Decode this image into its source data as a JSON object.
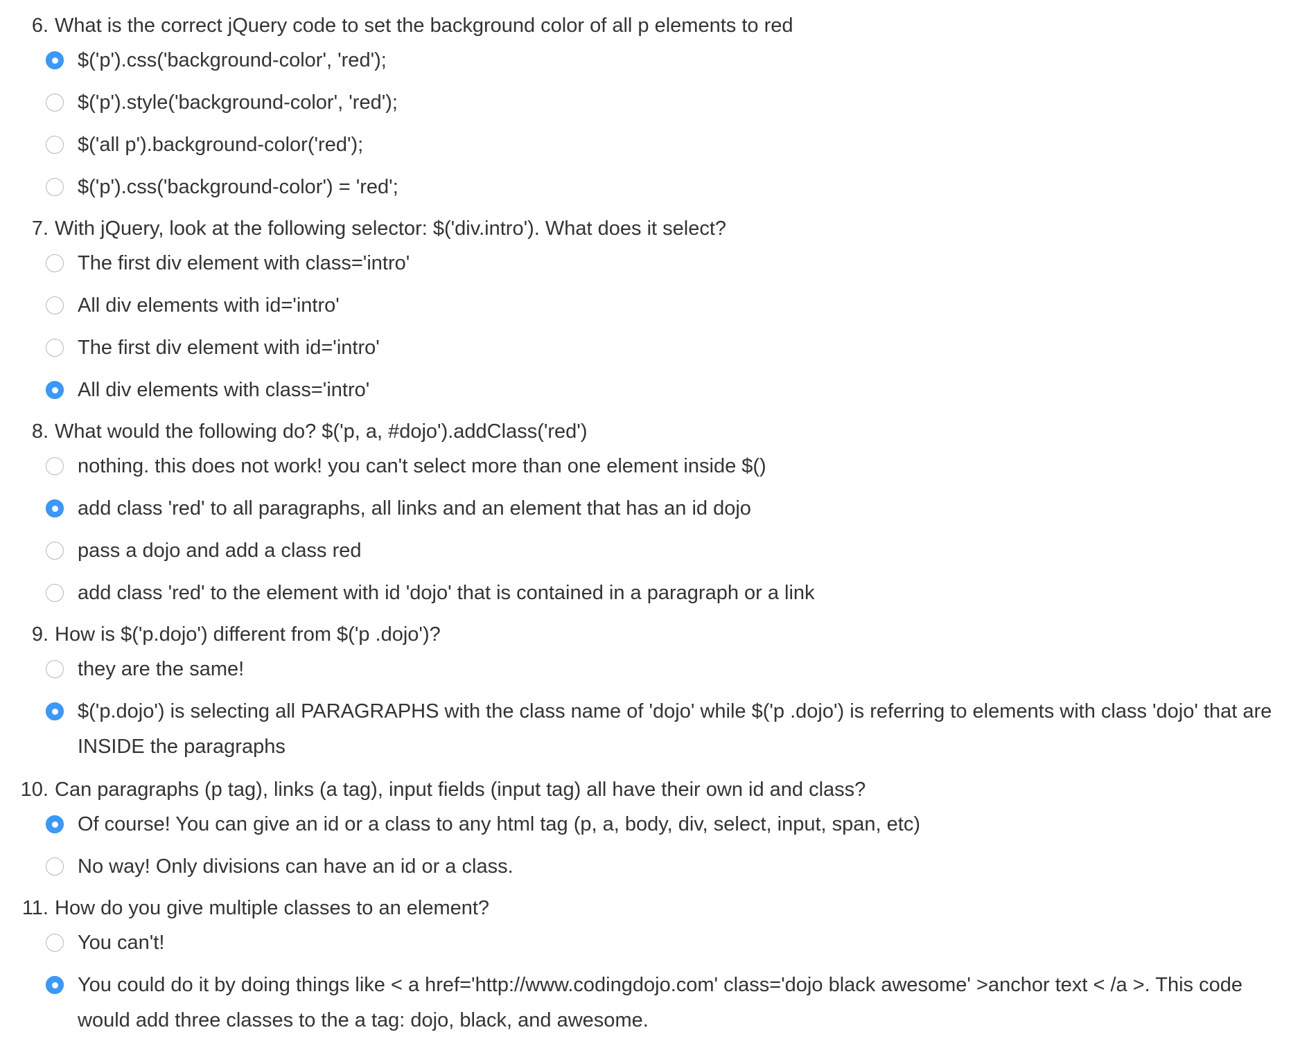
{
  "questions": [
    {
      "number": "6.",
      "text": "What is the correct jQuery code to set the background color of all p elements to red",
      "options": [
        {
          "label": "$('p').css('background-color', 'red');",
          "selected": true
        },
        {
          "label": "$('p').style('background-color', 'red');",
          "selected": false
        },
        {
          "label": "$('all p').background-color('red');",
          "selected": false
        },
        {
          "label": "$('p').css('background-color') = 'red';",
          "selected": false
        }
      ]
    },
    {
      "number": "7.",
      "text": "With jQuery, look at the following selector: $('div.intro'). What does it select?",
      "options": [
        {
          "label": "The first div element with class='intro'",
          "selected": false
        },
        {
          "label": "All div elements with id='intro'",
          "selected": false
        },
        {
          "label": "The first div element with id='intro'",
          "selected": false
        },
        {
          "label": "All div elements with class='intro'",
          "selected": true
        }
      ]
    },
    {
      "number": "8.",
      "text": "What would the following do? $('p, a, #dojo').addClass('red')",
      "options": [
        {
          "label": "nothing. this does not work! you can't select more than one element inside $()",
          "selected": false
        },
        {
          "label": "add class 'red' to all paragraphs, all links and an element that has an id dojo",
          "selected": true
        },
        {
          "label": "pass a dojo and add a class red",
          "selected": false
        },
        {
          "label": "add class 'red' to the element with id 'dojo' that is contained in a paragraph or a link",
          "selected": false
        }
      ]
    },
    {
      "number": "9.",
      "text": "How is $('p.dojo') different from $('p .dojo')?",
      "options": [
        {
          "label": "they are the same!",
          "selected": false
        },
        {
          "label": "$('p.dojo') is selecting all PARAGRAPHS with the class name of 'dojo' while $('p .dojo') is referring to elements with class 'dojo' that are INSIDE the paragraphs",
          "selected": true
        }
      ]
    },
    {
      "number": "10.",
      "text": "Can paragraphs (p tag), links (a tag), input fields (input tag) all have their own id and class?",
      "options": [
        {
          "label": "Of course! You can give an id or a class to any html tag (p, a, body, div, select, input, span, etc)",
          "selected": true
        },
        {
          "label": "No way! Only divisions can have an id or a class.",
          "selected": false
        }
      ]
    },
    {
      "number": "11.",
      "text": "How do you give multiple classes to an element?",
      "options": [
        {
          "label": "You can't!",
          "selected": false
        },
        {
          "label": "You could do it by doing things like < a href='http://www.codingdojo.com' class='dojo black awesome' >anchor text < /a >. This code would add three classes to the a tag: dojo, black, and awesome.",
          "selected": true
        }
      ]
    }
  ],
  "colors": {
    "accent": "#3b99fc",
    "text": "#333333",
    "radio_border": "#b8b8b8"
  }
}
